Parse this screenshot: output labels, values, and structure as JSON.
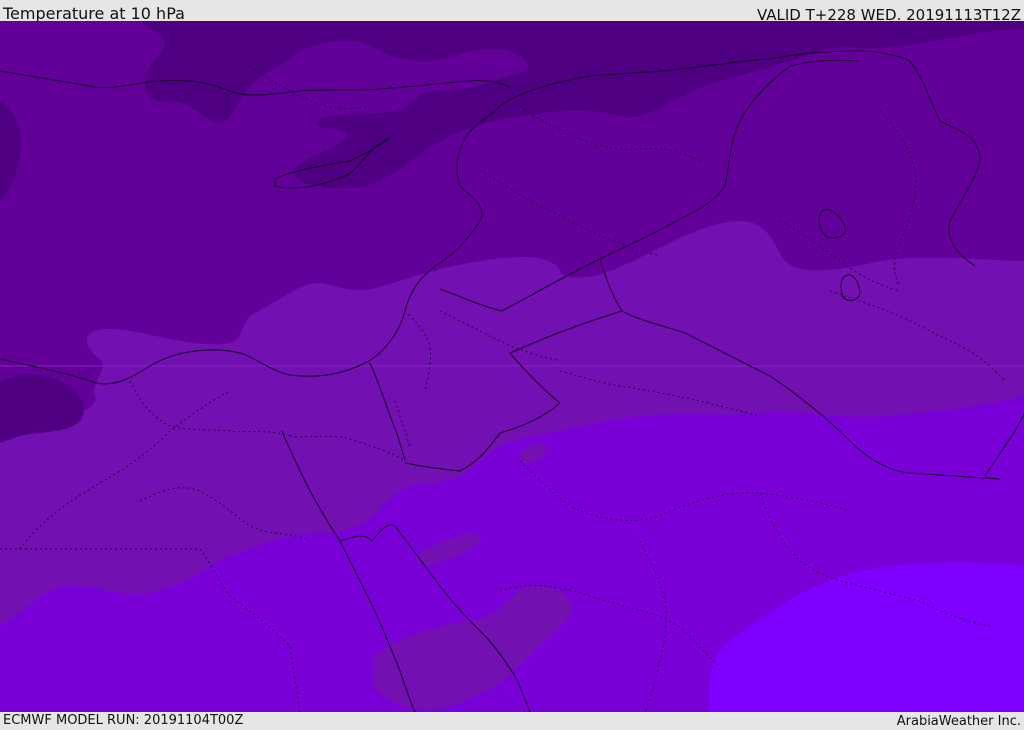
{
  "header": {
    "title": "Temperature at 10 hPa",
    "valid": "VALID T+228 WED. 20191113T12Z"
  },
  "footer": {
    "model_run": "ECMWF MODEL RUN: 20191104T00Z",
    "credit": "ArabiaWeather Inc."
  },
  "map": {
    "field": "temperature",
    "level": "10 hPa",
    "shading_colors": {
      "darkest": "#4f0082",
      "dark": "#64009a",
      "mid": "#7310b2",
      "light": "#7a00d8",
      "lightest": "#7f00ff"
    },
    "boundary_color": "#1a0033"
  }
}
